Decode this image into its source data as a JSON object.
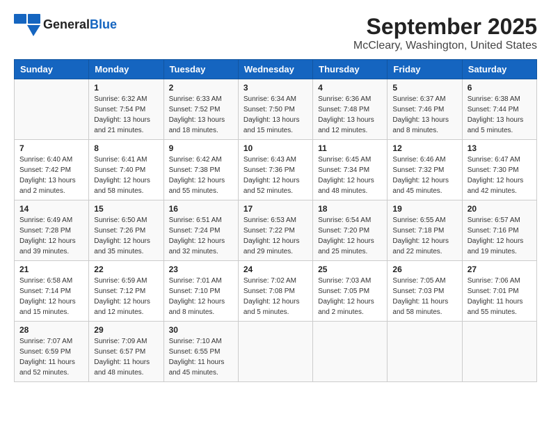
{
  "header": {
    "logo_general": "General",
    "logo_blue": "Blue",
    "title": "September 2025",
    "subtitle": "McCleary, Washington, United States"
  },
  "days_of_week": [
    "Sunday",
    "Monday",
    "Tuesday",
    "Wednesday",
    "Thursday",
    "Friday",
    "Saturday"
  ],
  "weeks": [
    [
      {
        "day": "",
        "info": ""
      },
      {
        "day": "1",
        "info": "Sunrise: 6:32 AM\nSunset: 7:54 PM\nDaylight: 13 hours\nand 21 minutes."
      },
      {
        "day": "2",
        "info": "Sunrise: 6:33 AM\nSunset: 7:52 PM\nDaylight: 13 hours\nand 18 minutes."
      },
      {
        "day": "3",
        "info": "Sunrise: 6:34 AM\nSunset: 7:50 PM\nDaylight: 13 hours\nand 15 minutes."
      },
      {
        "day": "4",
        "info": "Sunrise: 6:36 AM\nSunset: 7:48 PM\nDaylight: 13 hours\nand 12 minutes."
      },
      {
        "day": "5",
        "info": "Sunrise: 6:37 AM\nSunset: 7:46 PM\nDaylight: 13 hours\nand 8 minutes."
      },
      {
        "day": "6",
        "info": "Sunrise: 6:38 AM\nSunset: 7:44 PM\nDaylight: 13 hours\nand 5 minutes."
      }
    ],
    [
      {
        "day": "7",
        "info": "Sunrise: 6:40 AM\nSunset: 7:42 PM\nDaylight: 13 hours\nand 2 minutes."
      },
      {
        "day": "8",
        "info": "Sunrise: 6:41 AM\nSunset: 7:40 PM\nDaylight: 12 hours\nand 58 minutes."
      },
      {
        "day": "9",
        "info": "Sunrise: 6:42 AM\nSunset: 7:38 PM\nDaylight: 12 hours\nand 55 minutes."
      },
      {
        "day": "10",
        "info": "Sunrise: 6:43 AM\nSunset: 7:36 PM\nDaylight: 12 hours\nand 52 minutes."
      },
      {
        "day": "11",
        "info": "Sunrise: 6:45 AM\nSunset: 7:34 PM\nDaylight: 12 hours\nand 48 minutes."
      },
      {
        "day": "12",
        "info": "Sunrise: 6:46 AM\nSunset: 7:32 PM\nDaylight: 12 hours\nand 45 minutes."
      },
      {
        "day": "13",
        "info": "Sunrise: 6:47 AM\nSunset: 7:30 PM\nDaylight: 12 hours\nand 42 minutes."
      }
    ],
    [
      {
        "day": "14",
        "info": "Sunrise: 6:49 AM\nSunset: 7:28 PM\nDaylight: 12 hours\nand 39 minutes."
      },
      {
        "day": "15",
        "info": "Sunrise: 6:50 AM\nSunset: 7:26 PM\nDaylight: 12 hours\nand 35 minutes."
      },
      {
        "day": "16",
        "info": "Sunrise: 6:51 AM\nSunset: 7:24 PM\nDaylight: 12 hours\nand 32 minutes."
      },
      {
        "day": "17",
        "info": "Sunrise: 6:53 AM\nSunset: 7:22 PM\nDaylight: 12 hours\nand 29 minutes."
      },
      {
        "day": "18",
        "info": "Sunrise: 6:54 AM\nSunset: 7:20 PM\nDaylight: 12 hours\nand 25 minutes."
      },
      {
        "day": "19",
        "info": "Sunrise: 6:55 AM\nSunset: 7:18 PM\nDaylight: 12 hours\nand 22 minutes."
      },
      {
        "day": "20",
        "info": "Sunrise: 6:57 AM\nSunset: 7:16 PM\nDaylight: 12 hours\nand 19 minutes."
      }
    ],
    [
      {
        "day": "21",
        "info": "Sunrise: 6:58 AM\nSunset: 7:14 PM\nDaylight: 12 hours\nand 15 minutes."
      },
      {
        "day": "22",
        "info": "Sunrise: 6:59 AM\nSunset: 7:12 PM\nDaylight: 12 hours\nand 12 minutes."
      },
      {
        "day": "23",
        "info": "Sunrise: 7:01 AM\nSunset: 7:10 PM\nDaylight: 12 hours\nand 8 minutes."
      },
      {
        "day": "24",
        "info": "Sunrise: 7:02 AM\nSunset: 7:08 PM\nDaylight: 12 hours\nand 5 minutes."
      },
      {
        "day": "25",
        "info": "Sunrise: 7:03 AM\nSunset: 7:05 PM\nDaylight: 12 hours\nand 2 minutes."
      },
      {
        "day": "26",
        "info": "Sunrise: 7:05 AM\nSunset: 7:03 PM\nDaylight: 11 hours\nand 58 minutes."
      },
      {
        "day": "27",
        "info": "Sunrise: 7:06 AM\nSunset: 7:01 PM\nDaylight: 11 hours\nand 55 minutes."
      }
    ],
    [
      {
        "day": "28",
        "info": "Sunrise: 7:07 AM\nSunset: 6:59 PM\nDaylight: 11 hours\nand 52 minutes."
      },
      {
        "day": "29",
        "info": "Sunrise: 7:09 AM\nSunset: 6:57 PM\nDaylight: 11 hours\nand 48 minutes."
      },
      {
        "day": "30",
        "info": "Sunrise: 7:10 AM\nSunset: 6:55 PM\nDaylight: 11 hours\nand 45 minutes."
      },
      {
        "day": "",
        "info": ""
      },
      {
        "day": "",
        "info": ""
      },
      {
        "day": "",
        "info": ""
      },
      {
        "day": "",
        "info": ""
      }
    ]
  ]
}
